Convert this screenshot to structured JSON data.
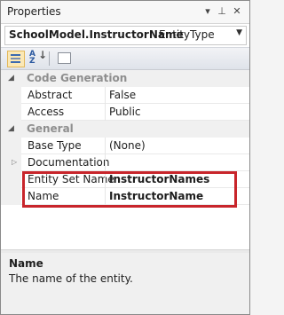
{
  "window": {
    "title": "Properties"
  },
  "selector": {
    "object_name": "SchoolModel.InstructorName",
    "object_type": "EntityType"
  },
  "categories": [
    {
      "label": "Code Generation",
      "properties": [
        {
          "name": "Abstract",
          "value": "False"
        },
        {
          "name": "Access",
          "value": "Public"
        }
      ]
    },
    {
      "label": "General",
      "properties": [
        {
          "name": "Base Type",
          "value": "(None)"
        },
        {
          "name": "Documentation",
          "value": ""
        },
        {
          "name": "Entity Set Name",
          "value": "InstructorNames"
        },
        {
          "name": "Name",
          "value": "InstructorName"
        }
      ]
    }
  ],
  "description": {
    "title": "Name",
    "text": "The name of the entity."
  },
  "icons": [
    "pin-icon",
    "close-icon",
    "dropdown-icon",
    "categorized-icon",
    "alphabetical-icon",
    "property-pages-icon"
  ]
}
